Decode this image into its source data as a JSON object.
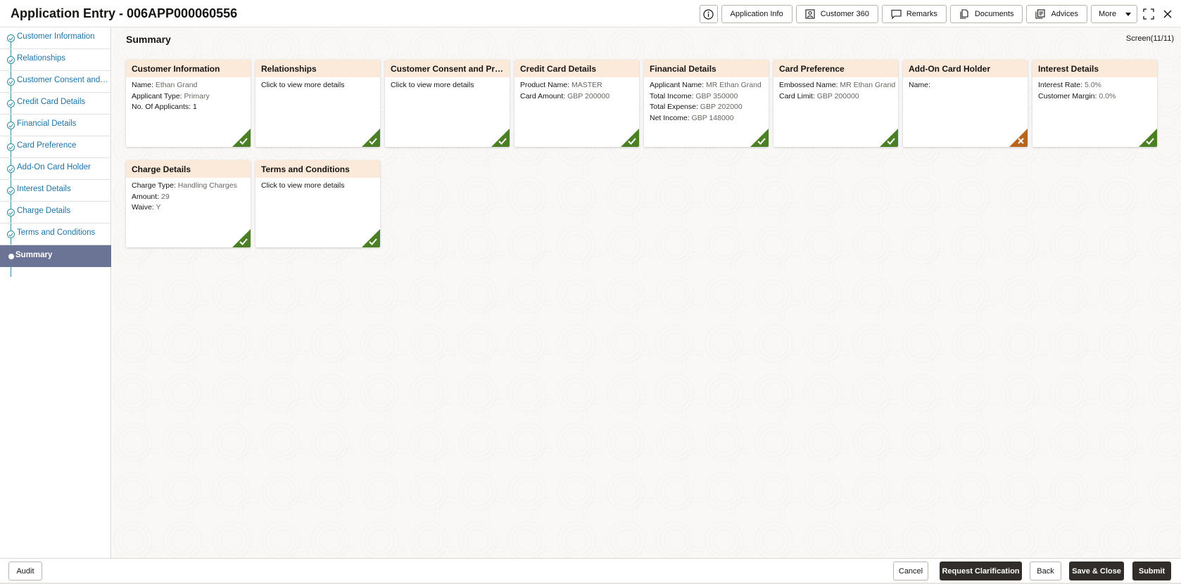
{
  "header": {
    "title": "Application Entry - 006APP000060556",
    "buttons": {
      "info_icon": "info-icon",
      "application_info": "Application Info",
      "customer_360": "Customer 360",
      "remarks": "Remarks",
      "documents": "Documents",
      "advices": "Advices",
      "more": "More"
    }
  },
  "sidebar": {
    "items": [
      {
        "label": "Customer Information"
      },
      {
        "label": "Relationships"
      },
      {
        "label": "Customer Consent and Preferences"
      },
      {
        "label": "Credit Card Details"
      },
      {
        "label": "Financial Details"
      },
      {
        "label": "Card Preference"
      },
      {
        "label": "Add-On Card Holder"
      },
      {
        "label": "Interest Details"
      },
      {
        "label": "Charge Details"
      },
      {
        "label": "Terms and Conditions"
      },
      {
        "label": "Summary"
      }
    ],
    "active_index": 10
  },
  "main": {
    "title": "Summary",
    "screen_count": "Screen(11/11)",
    "cards": [
      {
        "title": "Customer Information",
        "status": "complete",
        "lines": [
          {
            "label": "Name: ",
            "value": "Ethan Grand"
          },
          {
            "label": "Applicant Type: ",
            "value": "Primary"
          },
          {
            "label": "No. Of Applicants: 1",
            "value": ""
          }
        ]
      },
      {
        "title": "Relationships",
        "status": "complete",
        "lines": [
          {
            "label": "Click to view more details",
            "value": ""
          }
        ]
      },
      {
        "title": "Customer Consent and Pref...",
        "status": "complete",
        "lines": [
          {
            "label": "Click to view more details",
            "value": ""
          }
        ]
      },
      {
        "title": "Credit Card Details",
        "status": "complete",
        "lines": [
          {
            "label": "Product Name: ",
            "value": "MASTER"
          },
          {
            "label": "Card Amount: ",
            "value": "GBP 200000"
          }
        ]
      },
      {
        "title": "Financial Details",
        "status": "complete",
        "lines": [
          {
            "label": "Applicant Name: ",
            "value": "MR Ethan Grand"
          },
          {
            "label": "Total Income: ",
            "value": "GBP 350000"
          },
          {
            "label": "Total Expense: ",
            "value": "GBP 202000"
          },
          {
            "label": "Net Income: ",
            "value": "GBP 148000"
          }
        ]
      },
      {
        "title": "Card Preference",
        "status": "complete",
        "lines": [
          {
            "label": "Embossed Name: ",
            "value": "MR Ethan Grand"
          },
          {
            "label": "Card Limit: ",
            "value": "GBP 200000"
          }
        ]
      },
      {
        "title": "Add-On Card Holder",
        "status": "incomplete",
        "lines": [
          {
            "label": "Name:",
            "value": ""
          }
        ]
      },
      {
        "title": "Interest Details",
        "status": "complete",
        "lines": [
          {
            "label": "Interest Rate: ",
            "value": "5.0%"
          },
          {
            "label": "Customer Margin: ",
            "value": "0.0%"
          }
        ]
      },
      {
        "title": "Charge Details",
        "status": "complete",
        "lines": [
          {
            "label": "Charge Type: ",
            "value": "Handling Charges"
          },
          {
            "label": "Amount: ",
            "value": "29"
          },
          {
            "label": "Waive: ",
            "value": "Y"
          }
        ]
      },
      {
        "title": "Terms and Conditions",
        "status": "complete",
        "lines": [
          {
            "label": "Click to view more details",
            "value": ""
          }
        ]
      }
    ],
    "status_colors": {
      "complete": "#4b7f24",
      "incomplete": "#b5651d"
    }
  },
  "footer": {
    "audit": "Audit",
    "cancel": "Cancel",
    "request_clarification": "Request Clarification",
    "back": "Back",
    "save_close": "Save & Close",
    "submit": "Submit"
  }
}
